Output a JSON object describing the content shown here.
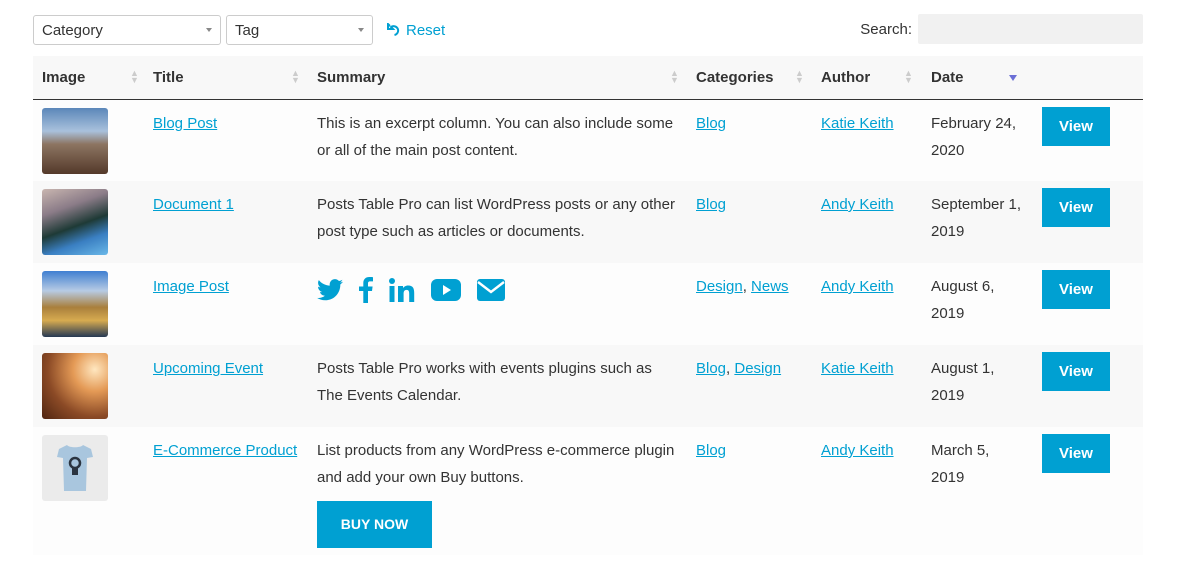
{
  "filters": {
    "category_label": "Category",
    "tag_label": "Tag",
    "reset_label": "Reset"
  },
  "search": {
    "label": "Search:",
    "value": "",
    "placeholder": ""
  },
  "colors": {
    "accent": "#00a0d2",
    "sort_active": "#6b6fd6",
    "text": "#333333"
  },
  "table": {
    "columns": [
      {
        "label": "Image",
        "sortable": false
      },
      {
        "label": "Title",
        "sortable": true
      },
      {
        "label": "Summary",
        "sortable": true
      },
      {
        "label": "Categories",
        "sortable": true
      },
      {
        "label": "Author",
        "sortable": true
      },
      {
        "label": "Date",
        "sortable": true,
        "sorted": "descending"
      },
      {
        "label": "",
        "sortable": false
      }
    ],
    "rows": [
      {
        "image": "pier-photo",
        "title": "Blog Post",
        "summary": "This is an excerpt column. You can also include some or all of the main post content.",
        "categories": [
          "Blog"
        ],
        "author": "Katie Keith",
        "date": "February 24, 2020",
        "button": "View"
      },
      {
        "image": "road-photo",
        "title": "Document 1",
        "summary": "Posts Table Pro can list WordPress posts or any other post type such as articles or documents.",
        "categories": [
          "Blog"
        ],
        "author": "Andy Keith",
        "date": "September 1, 2019",
        "button": "View"
      },
      {
        "image": "field-photo",
        "title": "Image Post",
        "summary_icons": [
          "twitter-icon",
          "facebook-icon",
          "linkedin-icon",
          "youtube-icon",
          "email-icon"
        ],
        "categories": [
          "Design",
          "News"
        ],
        "author": "Andy Keith",
        "date": "August 6, 2019",
        "button": "View"
      },
      {
        "image": "sunset-photo",
        "title": "Upcoming Event",
        "summary": "Posts Table Pro works with events plugins such as The Events Calendar.",
        "categories": [
          "Blog",
          "Design"
        ],
        "author": "Katie Keith",
        "date": "August 1, 2019",
        "button": "View"
      },
      {
        "image": "tshirt-photo",
        "title": "E-Commerce Product",
        "summary": "List products from any WordPress e-commerce plugin and add your own Buy buttons.",
        "buy_button": "BUY NOW",
        "categories": [
          "Blog"
        ],
        "author": "Andy Keith",
        "date": "March 5, 2019",
        "button": "View"
      }
    ]
  }
}
